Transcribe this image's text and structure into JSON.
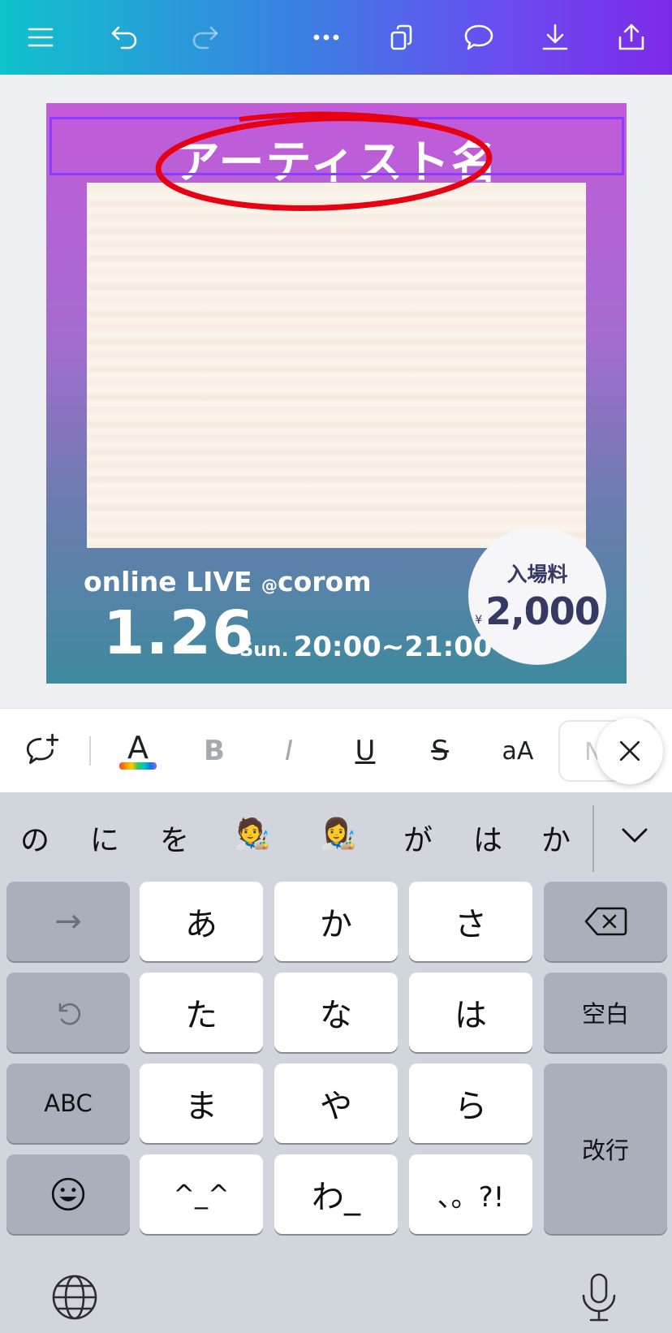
{
  "toolbar": {
    "icons": [
      "menu-icon",
      "undo-icon",
      "redo-icon",
      "more-icon",
      "copy-icon",
      "comment-icon",
      "download-icon",
      "share-icon"
    ]
  },
  "design": {
    "title": "アーティスト名",
    "line1_main": "online LIVE",
    "line1_at": "@",
    "line1_venue": "corom",
    "date": "1.26",
    "day": "Sun.",
    "time": "20:00~21:00",
    "price_label": "入場料",
    "price_currency": "¥",
    "price_value": "2,000"
  },
  "format_bar": {
    "color_label": "A",
    "bold": "B",
    "italic": "I",
    "underline": "U",
    "strike": "S",
    "case": "aA",
    "font_preview": "N"
  },
  "keyboard": {
    "candidates": [
      "の",
      "に",
      "を",
      "🧑‍🎨",
      "👩‍🎨",
      "が",
      "は",
      "か"
    ],
    "rows": [
      [
        "→",
        "あ",
        "か",
        "さ",
        "⌫"
      ],
      [
        "↺",
        "た",
        "な",
        "は",
        "空白"
      ],
      [
        "ABC",
        "ま",
        "や",
        "ら",
        "改行"
      ],
      [
        "☺",
        "^_^",
        "わ_",
        "、。?!"
      ]
    ]
  }
}
